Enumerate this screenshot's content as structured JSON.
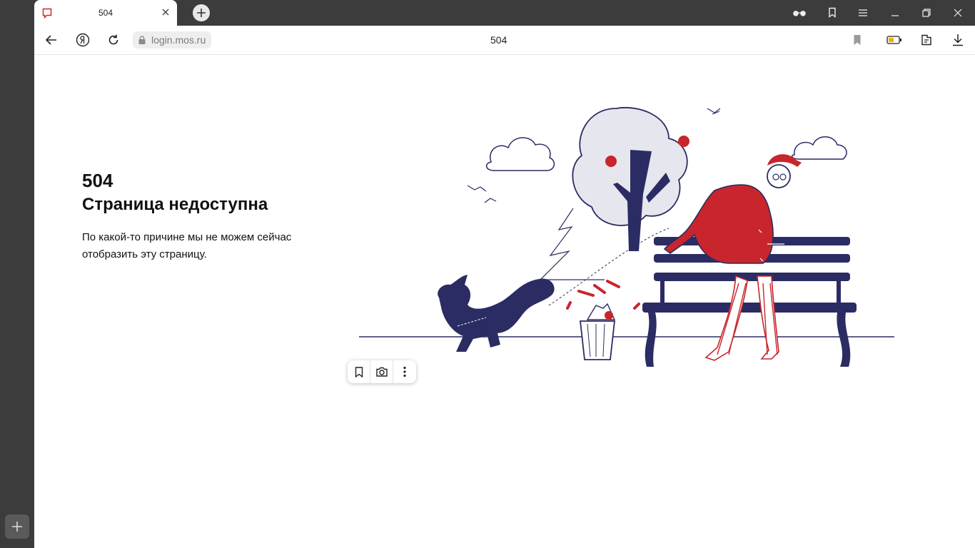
{
  "tab": {
    "title": "504"
  },
  "toolbar": {
    "url": "login.mos.ru",
    "page_title": "504"
  },
  "error": {
    "code": "504",
    "title": "Страница недоступна",
    "description": "По какой-то причине мы не можем сейчас отобразить эту страницу."
  },
  "colors": {
    "accent": "#c9252c",
    "navy": "#2b2c63",
    "chrome": "#3c3c3c"
  },
  "icons": [
    "bookmark-tab-icon",
    "close-icon",
    "plus-icon",
    "reading-glasses-icon",
    "collections-icon",
    "menu-icon",
    "minimize-icon",
    "restore-icon",
    "window-close-icon",
    "back-icon",
    "yandex-icon",
    "reload-icon",
    "lock-icon",
    "bookmark-icon",
    "battery-icon",
    "extensions-icon",
    "download-icon",
    "camera-icon",
    "more-icon"
  ]
}
